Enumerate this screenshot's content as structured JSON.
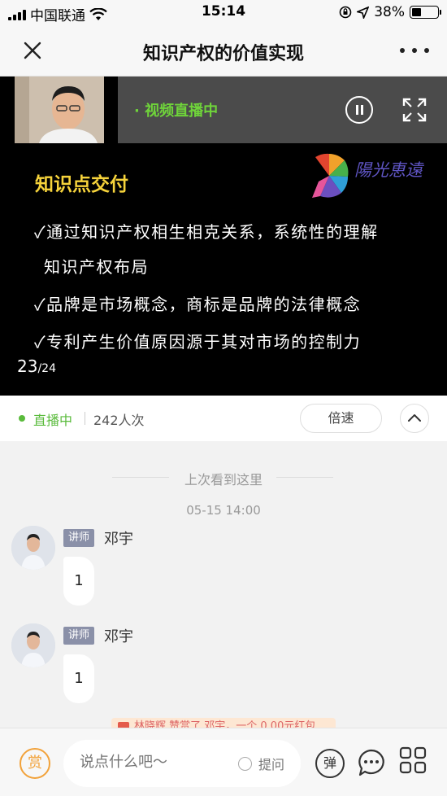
{
  "status_bar": {
    "carrier": "中国联通",
    "time": "15:14",
    "battery": "38%",
    "battery_level": 0.38
  },
  "nav": {
    "title": "知识产权的价值实现"
  },
  "video": {
    "live_label": "· 视频直播中",
    "slide_title": "知识点交付",
    "logo_text": "陽光恵遠",
    "bullets": [
      "✓通过知识产权相生相克关系，系统性的理解",
      "知识产权布局",
      "✓品牌是市场概念，商标是品牌的法律概念",
      "✓专利产生价值原因源于其对市场的控制力"
    ],
    "page_current": "23",
    "page_total": "/24"
  },
  "info_bar": {
    "status": "直播中",
    "viewers": "242人次",
    "speed_label": "倍速"
  },
  "chat": {
    "last_seen": "上次看到这里",
    "timestamp": "05-15 14:00",
    "messages": [
      {
        "role": "讲师",
        "sender": "邓宇",
        "text": "1"
      },
      {
        "role": "讲师",
        "sender": "邓宇",
        "text": "1"
      }
    ],
    "gift_banner": "林晓辉 赞赏了 邓宇，一个 0.00元红包"
  },
  "bottom": {
    "reward_label": "赏",
    "input_placeholder": "说点什么吧～",
    "ask_label": "提问",
    "danmu_label": "弹"
  },
  "colors": {
    "live_green": "#5abb3c",
    "slide_title_yellow": "#f6d33b",
    "reward_orange": "#f2a23a"
  }
}
